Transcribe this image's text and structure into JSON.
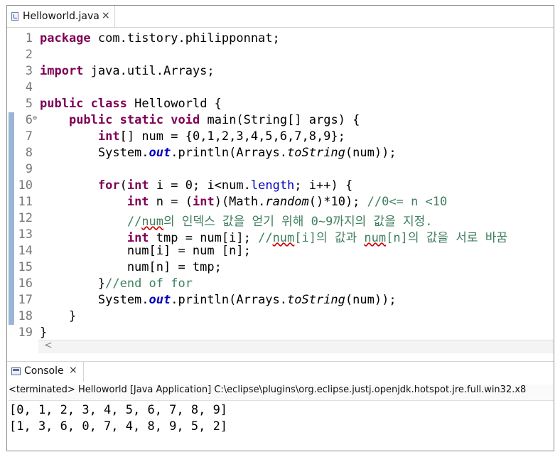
{
  "editor_tab": {
    "title": "Helloworld.java",
    "close": "×"
  },
  "lines": [
    {
      "num": "1",
      "segs": [
        {
          "t": "package",
          "c": "kw"
        },
        {
          "t": " com.tistory.philipponnat;",
          "c": ""
        }
      ]
    },
    {
      "num": "2",
      "segs": []
    },
    {
      "num": "3",
      "segs": [
        {
          "t": "import",
          "c": "kw"
        },
        {
          "t": " java.util.Arrays;",
          "c": ""
        }
      ]
    },
    {
      "num": "4",
      "segs": []
    },
    {
      "num": "5",
      "segs": [
        {
          "t": "public",
          "c": "kw"
        },
        {
          "t": " ",
          "c": ""
        },
        {
          "t": "class",
          "c": "kw"
        },
        {
          "t": " Helloworld {",
          "c": ""
        }
      ]
    },
    {
      "num": "6",
      "fold": "⊖",
      "segs": [
        {
          "t": "    ",
          "c": ""
        },
        {
          "t": "public",
          "c": "kw"
        },
        {
          "t": " ",
          "c": ""
        },
        {
          "t": "static",
          "c": "kw"
        },
        {
          "t": " ",
          "c": ""
        },
        {
          "t": "void",
          "c": "kw"
        },
        {
          "t": " main(String[] args) {",
          "c": ""
        }
      ]
    },
    {
      "num": "7",
      "segs": [
        {
          "t": "        ",
          "c": ""
        },
        {
          "t": "int",
          "c": "kw"
        },
        {
          "t": "[] num = {0,1,2,3,4,5,6,7,8,9};",
          "c": ""
        }
      ]
    },
    {
      "num": "8",
      "segs": [
        {
          "t": "        System.",
          "c": ""
        },
        {
          "t": "out",
          "c": "stc"
        },
        {
          "t": ".println(Arrays.",
          "c": ""
        },
        {
          "t": "toString",
          "c": "it"
        },
        {
          "t": "(num));",
          "c": ""
        }
      ]
    },
    {
      "num": "9",
      "segs": []
    },
    {
      "num": "10",
      "segs": [
        {
          "t": "        ",
          "c": ""
        },
        {
          "t": "for",
          "c": "kw"
        },
        {
          "t": "(",
          "c": ""
        },
        {
          "t": "int",
          "c": "kw"
        },
        {
          "t": " i = 0; i<num.",
          "c": ""
        },
        {
          "t": "length",
          "c": "fld"
        },
        {
          "t": "; i++) {",
          "c": ""
        }
      ]
    },
    {
      "num": "11",
      "segs": [
        {
          "t": "            ",
          "c": ""
        },
        {
          "t": "int",
          "c": "kw"
        },
        {
          "t": " n = (",
          "c": ""
        },
        {
          "t": "int",
          "c": "kw"
        },
        {
          "t": ")(Math.",
          "c": ""
        },
        {
          "t": "random",
          "c": "it"
        },
        {
          "t": "()*10); ",
          "c": ""
        },
        {
          "t": "//0<= n <10",
          "c": "cm"
        }
      ]
    },
    {
      "num": "12",
      "segs": [
        {
          "t": "            ",
          "c": ""
        },
        {
          "t": "//",
          "c": "cm"
        },
        {
          "t": "num",
          "c": "cm squig"
        },
        {
          "t": "의 인덱스 값을 얻기 위해 0~9까지의 값을 지정.",
          "c": "cm"
        }
      ]
    },
    {
      "num": "13",
      "segs": [
        {
          "t": "            ",
          "c": ""
        },
        {
          "t": "int",
          "c": "kw"
        },
        {
          "t": " tmp = num[i]; ",
          "c": ""
        },
        {
          "t": "//",
          "c": "cm"
        },
        {
          "t": "num",
          "c": "cm squig"
        },
        {
          "t": "[i]의 값과 ",
          "c": "cm"
        },
        {
          "t": "num",
          "c": "cm squig"
        },
        {
          "t": "[n]의 값을 서로 바꿈",
          "c": "cm"
        }
      ]
    },
    {
      "num": "14",
      "segs": [
        {
          "t": "            num[i] = num [n];",
          "c": ""
        }
      ]
    },
    {
      "num": "15",
      "segs": [
        {
          "t": "            num[n] = tmp;",
          "c": ""
        }
      ]
    },
    {
      "num": "16",
      "segs": [
        {
          "t": "        }",
          "c": ""
        },
        {
          "t": "//end of for",
          "c": "cm"
        }
      ]
    },
    {
      "num": "17",
      "segs": [
        {
          "t": "        System.",
          "c": ""
        },
        {
          "t": "out",
          "c": "stc"
        },
        {
          "t": ".println(Arrays.",
          "c": ""
        },
        {
          "t": "toString",
          "c": "it"
        },
        {
          "t": "(num));",
          "c": ""
        }
      ]
    },
    {
      "num": "18",
      "segs": [
        {
          "t": "    }",
          "c": ""
        }
      ]
    },
    {
      "num": "19",
      "segs": [
        {
          "t": "}",
          "c": ""
        }
      ]
    }
  ],
  "scroll_arrow": "<",
  "console": {
    "tab_label": "Console",
    "close": "×",
    "terminated": "<terminated> Helloworld [Java Application] C:\\eclipse\\plugins\\org.eclipse.justj.openjdk.hotspot.jre.full.win32.x8",
    "output": [
      "[0, 1, 2, 3, 4, 5, 6, 7, 8, 9]",
      "[1, 3, 6, 0, 7, 4, 8, 9, 5, 2]"
    ]
  },
  "colors": {
    "keyword": "#7f0055",
    "comment": "#3f7f5f",
    "field": "#0000c0",
    "ruler": "#9ab6d4"
  }
}
